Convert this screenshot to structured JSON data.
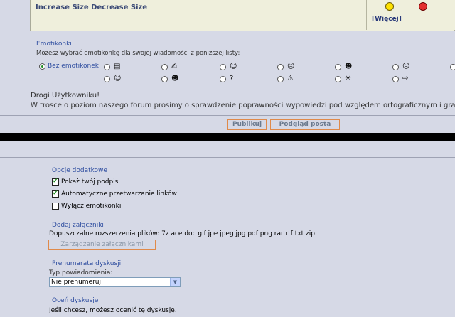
{
  "editor": {
    "increase_size": "Increase Size",
    "decrease_size": "Decrease Size",
    "more_smilies": "[Więcej]"
  },
  "emoticons": {
    "title": "Emotikonki",
    "subtitle": "Możesz wybrać emotikonkę dla swojej wiadomości z poniższej listy:",
    "none_label": "Bez emotikonek",
    "row1": [
      "▤",
      "✍",
      "☺",
      "☹",
      "☻",
      "☹",
      "☺"
    ],
    "row2": [
      "☺",
      "☻",
      "?",
      "⚠",
      "☀",
      "⇨"
    ]
  },
  "notice": {
    "greeting": "Drogi Użytkowniku!",
    "text": "W trosce o poziom naszego forum prosimy o sprawdzenie poprawności wypowiedzi pod względem ortograficznym i gramat"
  },
  "actions": {
    "publish": "Publikuj",
    "preview": "Podgląd posta"
  },
  "options": {
    "title": "Opcje dodatkowe",
    "items": [
      {
        "label": "Pokaż twój podpis",
        "checked": true
      },
      {
        "label": "Automatyczne przetwarzanie linków",
        "checked": true
      },
      {
        "label": "Wyłącz emotikonki",
        "checked": false
      }
    ]
  },
  "attachments": {
    "title": "Dodaj załączniki",
    "allowed": "Dopuszczalne rozszerzenia plików: 7z ace doc gif jpe jpeg jpg pdf png rar rtf txt zip",
    "manage_button": "Zarządzanie załącznikami"
  },
  "subscription": {
    "title": "Prenumarata dyskusji",
    "type_label": "Typ powiadomienia:",
    "selected": "Nie prenumeruj"
  },
  "rating": {
    "title": "Oceń dyskusję",
    "text": "Jeśli chcesz, możesz ocenić tę dyskusję."
  },
  "colors": {
    "accent_blue": "#2f4ea0",
    "button_border": "#e08a4a",
    "background": "#d6d9e6",
    "editor_bg": "#efefdc"
  }
}
